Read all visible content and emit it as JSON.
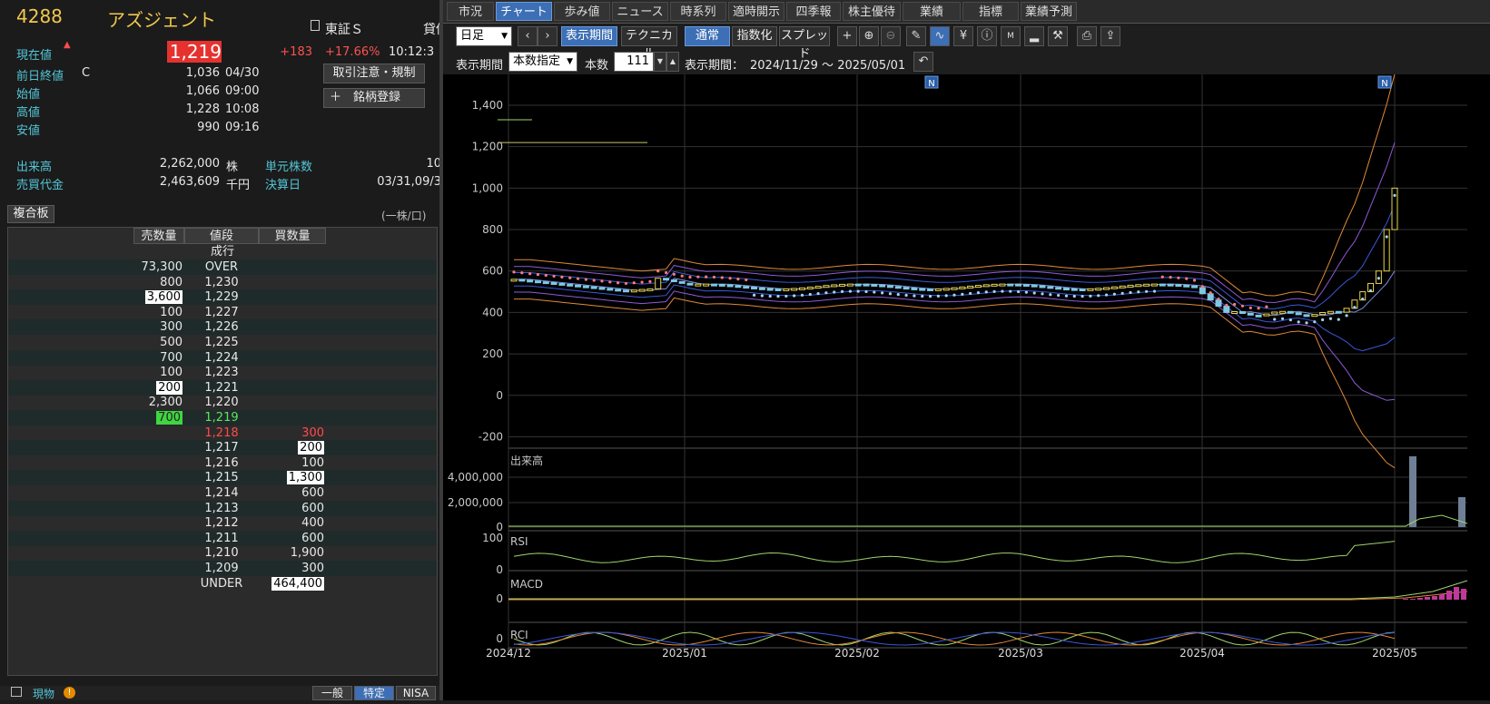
{
  "symbol": {
    "code": "4288",
    "name": "アズジェント",
    "market": "東証Ｓ",
    "market_extra": "貸借",
    "current_label": "現在値",
    "current_price": "1,219",
    "change": "+183",
    "change_pct": "+17.66%",
    "time": "10:12:3",
    "prev_close_label": "前日終値",
    "prev_close_flag": "C",
    "prev_close": "1,036",
    "prev_close_date": "04/30",
    "open_label": "始値",
    "open": "1,066",
    "open_time": "09:00",
    "high_label": "高値",
    "high": "1,228",
    "high_time": "10:08",
    "low_label": "安値",
    "low": "990",
    "low_time": "09:16",
    "volume_label": "出来高",
    "volume": "2,262,000",
    "volume_unit": "株",
    "unit_label": "単元株数",
    "unit_value": "10",
    "turnover_label": "売買代金",
    "turnover": "2,463,609",
    "turnover_unit": "千円",
    "settle_label": "決算日",
    "settle_value": "03/31,09/3",
    "btn_caution": "取引注意・規制",
    "btn_register": "＋　銘柄登録"
  },
  "board": {
    "title": "複合板",
    "unit_note": "(一株/口)",
    "headers": [
      "売数量",
      "値段",
      "買数量"
    ],
    "market_order": "成行",
    "rows": [
      {
        "sell": "73,300",
        "price": "OVER",
        "buy": ""
      },
      {
        "sell": "800",
        "price": "1,230",
        "buy": ""
      },
      {
        "sell": "3,600",
        "price": "1,229",
        "buy": "",
        "sell_hl": "w"
      },
      {
        "sell": "100",
        "price": "1,227",
        "buy": ""
      },
      {
        "sell": "300",
        "price": "1,226",
        "buy": ""
      },
      {
        "sell": "500",
        "price": "1,225",
        "buy": ""
      },
      {
        "sell": "700",
        "price": "1,224",
        "buy": ""
      },
      {
        "sell": "100",
        "price": "1,223",
        "buy": ""
      },
      {
        "sell": "200",
        "price": "1,221",
        "buy": "",
        "sell_hl": "w"
      },
      {
        "sell": "2,300",
        "price": "1,220",
        "buy": ""
      },
      {
        "sell": "700",
        "price": "1,219",
        "buy": "",
        "sell_hl": "g",
        "price_color": "#5fe35f"
      },
      {
        "sell": "",
        "price": "1,218",
        "buy": "300",
        "price_color": "#ff4b4b",
        "buy_color": "#ff4b4b"
      },
      {
        "sell": "",
        "price": "1,217",
        "buy": "200",
        "buy_hl": "w"
      },
      {
        "sell": "",
        "price": "1,216",
        "buy": "100"
      },
      {
        "sell": "",
        "price": "1,215",
        "buy": "1,300",
        "buy_hl": "w"
      },
      {
        "sell": "",
        "price": "1,214",
        "buy": "600"
      },
      {
        "sell": "",
        "price": "1,213",
        "buy": "600"
      },
      {
        "sell": "",
        "price": "1,212",
        "buy": "400"
      },
      {
        "sell": "",
        "price": "1,211",
        "buy": "600"
      },
      {
        "sell": "",
        "price": "1,210",
        "buy": "1,900"
      },
      {
        "sell": "",
        "price": "1,209",
        "buy": "300"
      },
      {
        "sell": "",
        "price": "UNDER",
        "buy": "464,400",
        "buy_hl": "w"
      }
    ]
  },
  "bottom": {
    "label": "現物",
    "tabs": [
      "一般",
      "特定",
      "NISA"
    ]
  },
  "tabs": [
    "市況",
    "チャート",
    "歩み値",
    "ニュース",
    "時系列",
    "適時開示",
    "四季報",
    "株主優待",
    "業績",
    "指標",
    "業績予測"
  ],
  "active_tab": 1,
  "toolbar": {
    "period_select": "日足",
    "btn_period": "表示期間",
    "btn_technical": "テクニカル",
    "btn_normal": "通常",
    "btn_index": "指数化",
    "btn_spread": "スプレッド",
    "range_label": "表示期間",
    "range_select": "本数指定",
    "count_label": "本数",
    "count_value": "111",
    "display_range_label": "表示期間：",
    "display_range": "2024/11/29 ～ 2025/05/01"
  },
  "chart": {
    "price_ticks": [
      "1,400",
      "1,200",
      "1,000",
      "800",
      "600",
      "400",
      "200",
      "0",
      "-200"
    ],
    "volume_label": "出来高",
    "volume_ticks": [
      "4,000,000",
      "2,000,000",
      "0"
    ],
    "rsi_label": "RSI",
    "rsi_ticks": [
      "100",
      "0"
    ],
    "macd_label": "MACD",
    "macd_ticks": [
      "0"
    ],
    "rci_label": "RCI",
    "rci_ticks": [
      "0"
    ],
    "x_labels": [
      "2024/12",
      "2025/01",
      "2025/02",
      "2025/03",
      "2025/04",
      "2025/05"
    ],
    "news_marker": "N"
  }
}
